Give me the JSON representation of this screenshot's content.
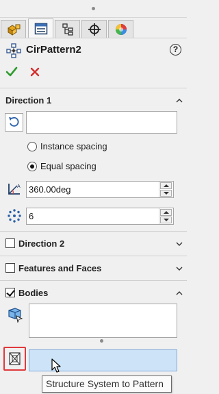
{
  "tabs": [
    {
      "name": "featuremanager-tab",
      "icon": "feature-manager-icon"
    },
    {
      "name": "propertymanager-tab",
      "icon": "property-manager-icon",
      "active": true
    },
    {
      "name": "configurationmanager-tab",
      "icon": "configuration-manager-icon"
    },
    {
      "name": "dimxpertmanager-tab",
      "icon": "crosshair-icon"
    },
    {
      "name": "displaymanager-tab",
      "icon": "appearance-icon"
    }
  ],
  "header": {
    "title": "CirPattern2",
    "help": "?"
  },
  "direction1": {
    "title": "Direction 1",
    "axis_value": "",
    "instance_spacing_label": "Instance spacing",
    "equal_spacing_label": "Equal spacing",
    "selected_spacing": "equal",
    "angle_value": "360.00deg",
    "instances_value": "6"
  },
  "direction2": {
    "title": "Direction 2",
    "checked": false
  },
  "features_and_faces": {
    "title": "Features and Faces",
    "checked": false
  },
  "bodies": {
    "title": "Bodies",
    "checked": true,
    "selection_value": ""
  },
  "structure_system": {
    "selection_value": "",
    "tooltip": "Structure System to Pattern"
  },
  "colors": {
    "ok_green": "#2e9b2e",
    "cancel_red": "#d42a2a",
    "active_field_bg": "#cde3f7",
    "highlight_red": "#e0393c"
  }
}
